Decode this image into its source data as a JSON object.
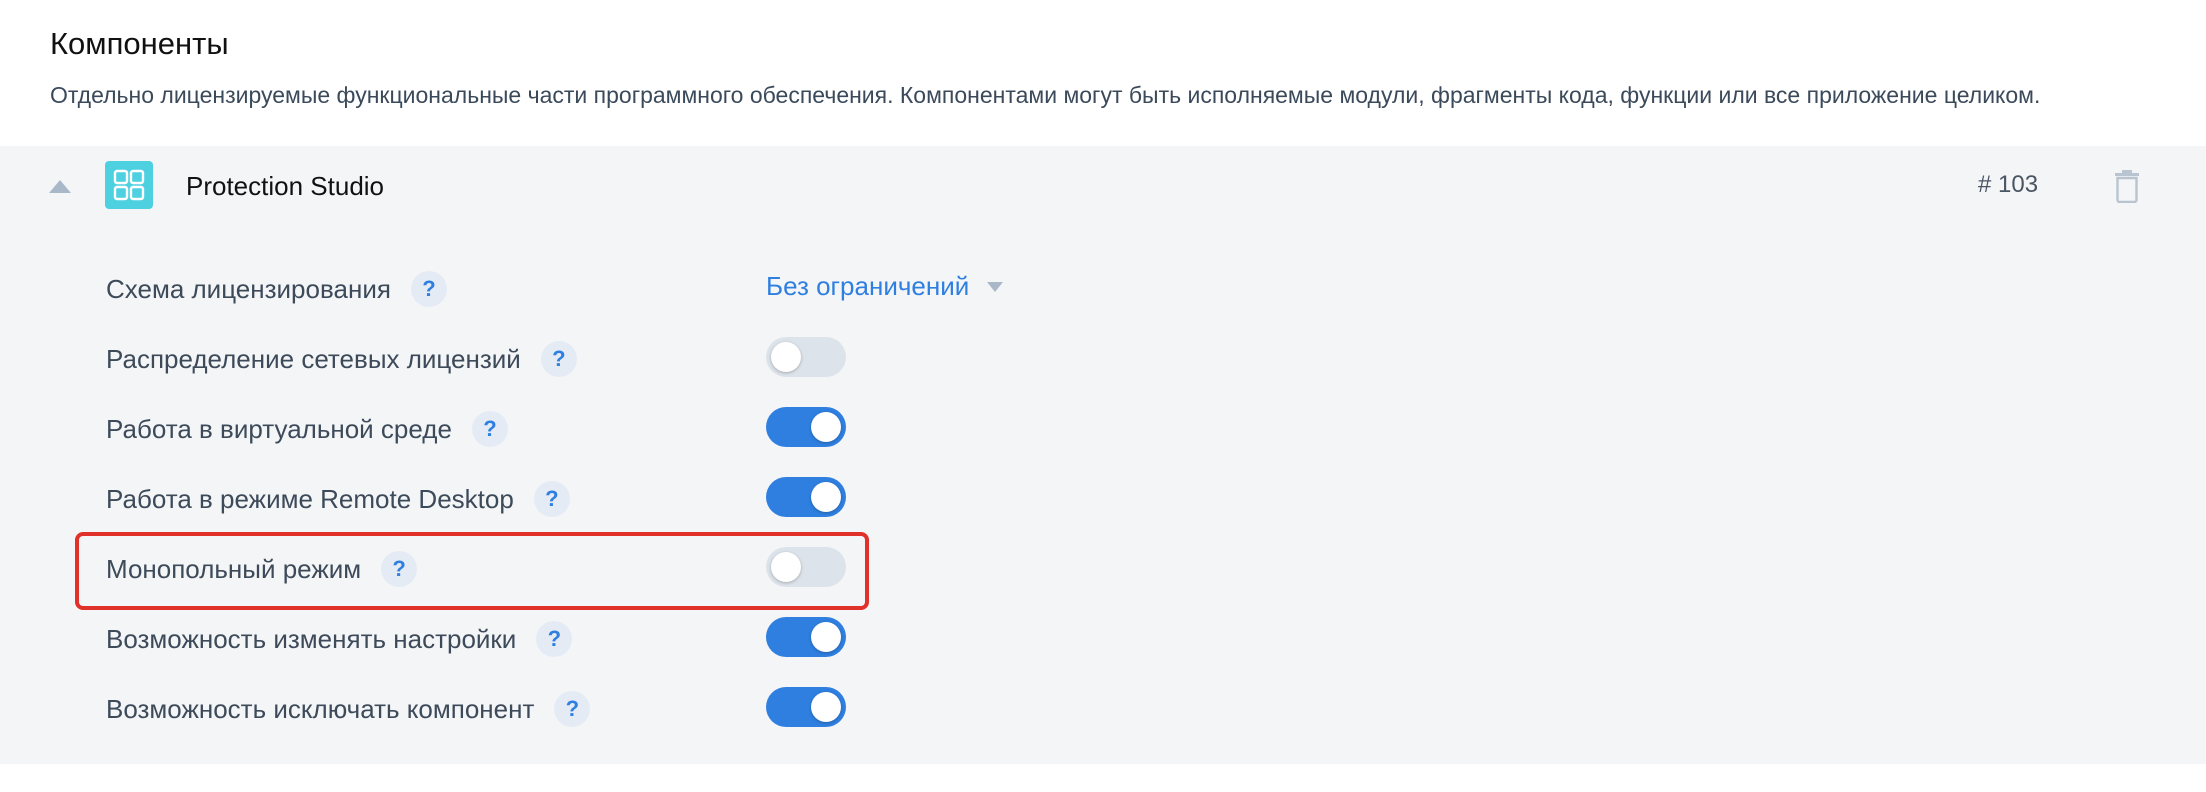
{
  "section": {
    "title": "Компоненты",
    "description": "Отдельно лицензируемые функциональные части программного обеспечения. Компонентами могут быть исполняемые модули, фрагменты кода, функции или все приложение целиком."
  },
  "component": {
    "name": "Protection Studio",
    "id_label": "# 103",
    "icon": "grid-icon",
    "icon_color": "#4dd0e0",
    "expanded": true
  },
  "settings": {
    "scheme": {
      "label": "Схема лицензирования",
      "help": "?",
      "value": "Без ограничений"
    },
    "toggles": [
      {
        "label": "Распределение сетевых лицензий",
        "help": "?",
        "on": false
      },
      {
        "label": "Работа в виртуальной среде",
        "help": "?",
        "on": true
      },
      {
        "label": "Работа в режиме Remote Desktop",
        "help": "?",
        "on": true
      },
      {
        "label": "Монопольный режим",
        "help": "?",
        "on": false,
        "highlighted": true
      },
      {
        "label": "Возможность изменять настройки",
        "help": "?",
        "on": true
      },
      {
        "label": "Возможность исключать компонент",
        "help": "?",
        "on": true
      }
    ]
  },
  "colors": {
    "accent": "#2f7fe0",
    "toggle_off": "#dde3ea",
    "highlight": "#e0322b",
    "panel_bg": "#f4f5f7"
  }
}
